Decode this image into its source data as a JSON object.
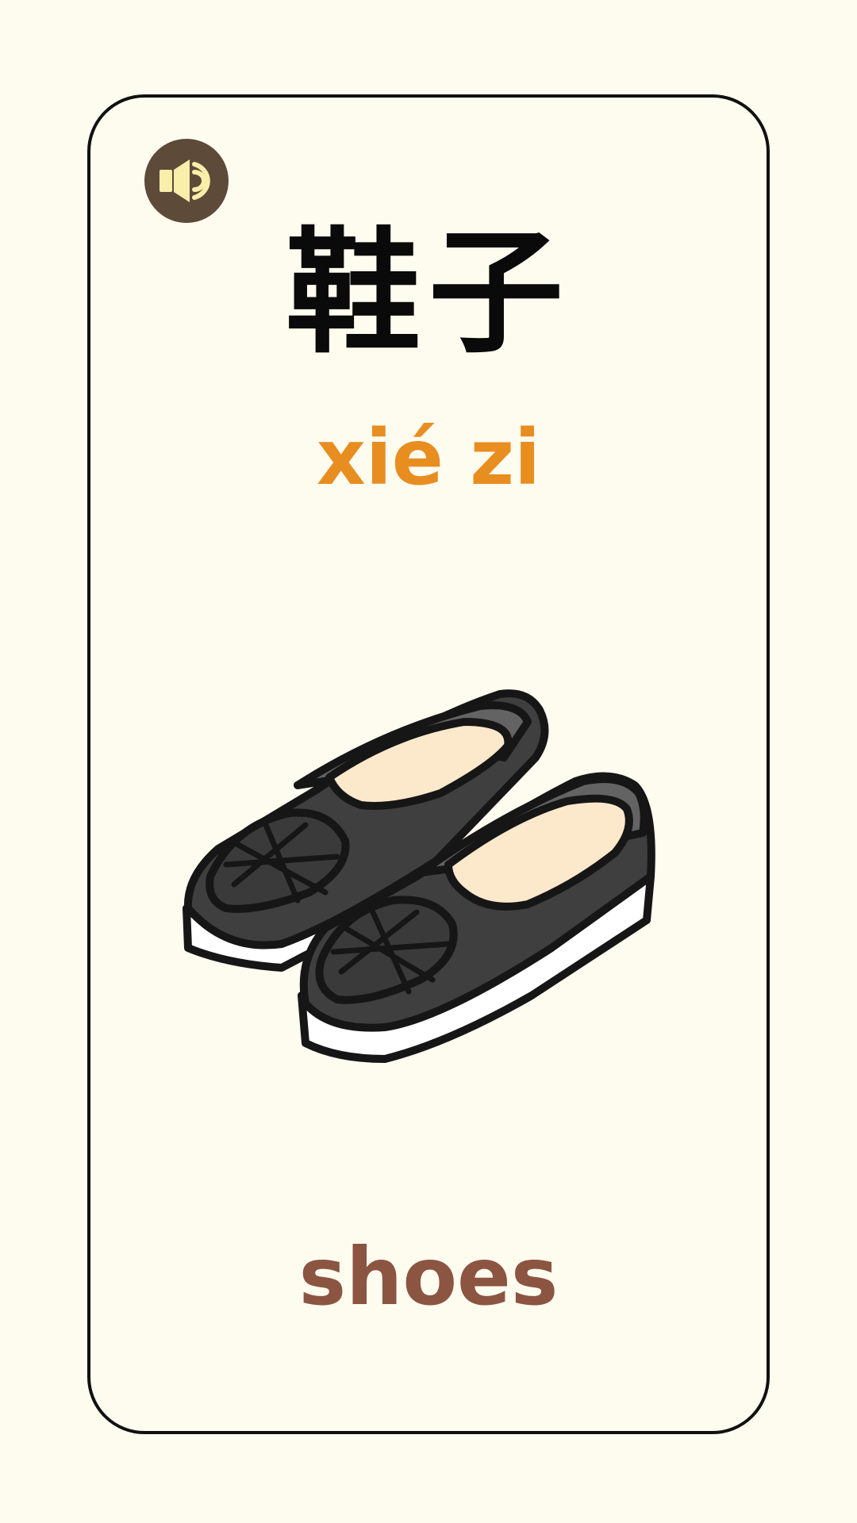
{
  "card": {
    "hanzi": "鞋子",
    "pinyin": "xié zi",
    "english": "shoes"
  },
  "icons": {
    "audio": "speaker-icon",
    "image": "shoes-icon"
  },
  "colors": {
    "background": "#fefbef",
    "card_border": "#111111",
    "pinyin": "#e88d1f",
    "english": "#8b5542",
    "speaker_bg": "#5d4a39",
    "speaker_glyph": "#f9eeaa"
  }
}
